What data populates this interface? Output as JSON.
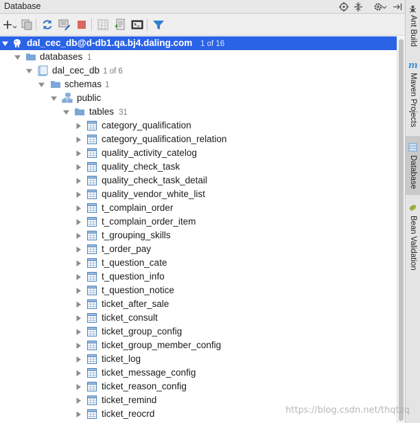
{
  "window": {
    "title": "Database"
  },
  "toolbar": {
    "buttons": [
      "add-icon",
      "copy-icon",
      "refresh-icon",
      "properties-icon",
      "stop-icon",
      "table-view-icon",
      "jump-to-source-icon",
      "console-icon",
      "filter-icon"
    ]
  },
  "tree": {
    "connection": {
      "label": "dal_cec_db@d-db1.qa.bj4.daling.com",
      "count": "1 of 16"
    },
    "databases": {
      "label": "databases",
      "count": "1"
    },
    "database": {
      "label": "dal_cec_db",
      "count": "1 of 6"
    },
    "schemas": {
      "label": "schemas",
      "count": "1"
    },
    "schema": {
      "label": "public"
    },
    "tables_folder": {
      "label": "tables",
      "count": "31"
    },
    "tables": [
      "category_qualification",
      "category_qualification_relation",
      "quality_activity_catelog",
      "quality_check_task",
      "quality_check_task_detail",
      "quality_vendor_white_list",
      "t_complain_order",
      "t_complain_order_item",
      "t_grouping_skills",
      "t_order_pay",
      "t_question_cate",
      "t_question_info",
      "t_question_notice",
      "ticket_after_sale",
      "ticket_consult",
      "ticket_group_config",
      "ticket_group_member_config",
      "ticket_log",
      "ticket_message_config",
      "ticket_reason_config",
      "ticket_remind",
      "ticket_reocrd"
    ]
  },
  "side_tabs": [
    {
      "label": "Ant Build",
      "icon": "ant-icon"
    },
    {
      "label": "Maven Projects",
      "icon": "maven-icon"
    },
    {
      "label": "Database",
      "icon": "database-icon",
      "active": true
    },
    {
      "label": "Bean Validation",
      "icon": "bean-icon"
    }
  ],
  "watermark": "https://blog.csdn.net/thqtzq",
  "colors": {
    "selection": "#2b63e6",
    "folder": "#6f9fd4",
    "table_icon": "#4a7fb5"
  }
}
